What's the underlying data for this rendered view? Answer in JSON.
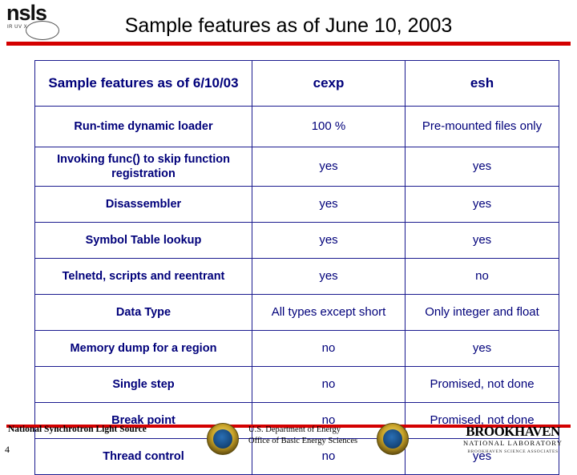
{
  "slide": {
    "title": "Sample features as of June 10, 2003",
    "page_number": "4",
    "accent_color": "#d40000",
    "table_text_color": "#00007a"
  },
  "logo": {
    "wordmark": "nsls",
    "sublabel": "IR  UV  X"
  },
  "table": {
    "headers": [
      "Sample features as of 6/10/03",
      "cexp",
      "esh"
    ],
    "rows": [
      {
        "feature": "Run-time dynamic loader",
        "cexp": "100 %",
        "esh": "Pre-mounted files only"
      },
      {
        "feature": "Invoking func() to skip function registration",
        "cexp": "yes",
        "esh": "yes"
      },
      {
        "feature": "Disassembler",
        "cexp": "yes",
        "esh": "yes"
      },
      {
        "feature": "Symbol Table lookup",
        "cexp": "yes",
        "esh": "yes"
      },
      {
        "feature": "Telnetd, scripts and reentrant",
        "cexp": "yes",
        "esh": "no"
      },
      {
        "feature": "Data Type",
        "cexp": "All types except short",
        "esh": "Only integer and float"
      },
      {
        "feature": "Memory dump for a region",
        "cexp": "no",
        "esh": "yes"
      },
      {
        "feature": "Single step",
        "cexp": "no",
        "esh": "Promised, not done"
      },
      {
        "feature": "Break point",
        "cexp": "no",
        "esh": "Promised, not done"
      },
      {
        "feature": "Thread control",
        "cexp": "no",
        "esh": "yes"
      }
    ]
  },
  "footer": {
    "left": "National Synchrotron Light Source",
    "center_line1": "U.S. Department of Energy",
    "center_line2": "Office of Basic Energy Sciences",
    "bnl_name": "BROOKHAVEN",
    "bnl_sub": "NATIONAL LABORATORY",
    "bnl_tagline": "BROOKHAVEN SCIENCE ASSOCIATES"
  }
}
